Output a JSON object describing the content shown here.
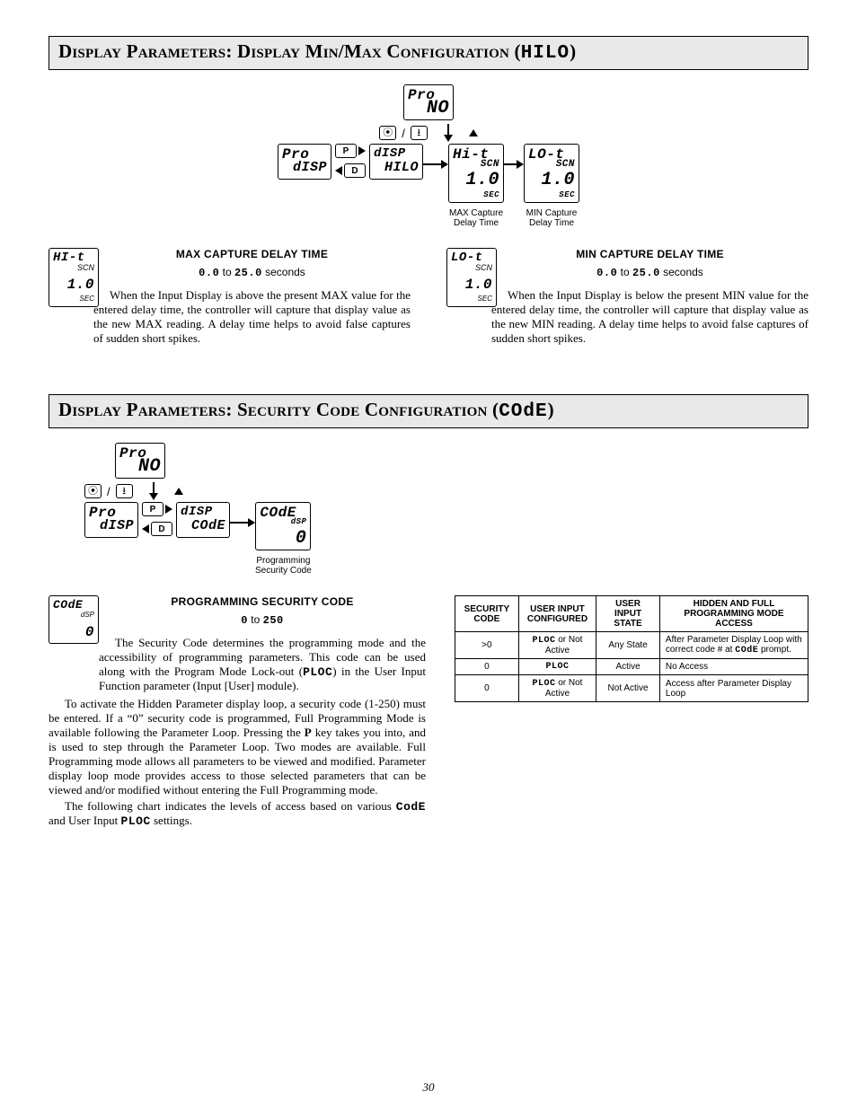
{
  "section1": {
    "title_prefix": "D",
    "title_a": "isplay",
    "title_b": " P",
    "title_c": "arameters",
    "title_mid": ": D",
    "title_d": "isplay",
    "title_e": " M",
    "title_f": "in",
    "title_slash": "/M",
    "title_g": "ax",
    "title_h": " C",
    "title_i": "onfiguration",
    "title_paren_open": " (",
    "title_seg": "HILO",
    "title_paren_close": ")"
  },
  "diagram1": {
    "pro": "Pro",
    "no": "NO",
    "disp": "dISP",
    "hilo": "HILO",
    "hi_t": "Hi-t",
    "lo_t": "LO-t",
    "scn": "SCN",
    "val": "1.0",
    "sec": "SEC",
    "btn_p": "P",
    "btn_d": "D",
    "max_cap_caption_l1": "MAX Capture",
    "max_cap_caption_l2": "Delay Time",
    "min_cap_caption_l1": "MIN Capture",
    "min_cap_caption_l2": "Delay Time"
  },
  "max_block": {
    "lcd_top": "HI-t",
    "lcd_scn": "SCN",
    "lcd_val": "1.0",
    "lcd_sec": "SEC",
    "heading": "MAX CAPTURE DELAY TIME",
    "range_a": "0.0",
    "range_mid": " to ",
    "range_b": "25.0",
    "range_suffix": "  seconds",
    "body": "When the Input Display is above the present MAX value for the entered delay time, the controller will capture that display value as the new MAX reading. A delay time helps to avoid false captures of sudden short spikes."
  },
  "min_block": {
    "lcd_top": "LO-t",
    "lcd_scn": "SCN",
    "lcd_val": "1.0",
    "lcd_sec": "SEC",
    "heading": "MIN CAPTURE DELAY TIME",
    "range_a": "0.0",
    "range_mid": " to ",
    "range_b": "25.0",
    "range_suffix": "  seconds",
    "body": "When the Input Display is below the present MIN value for the entered delay time, the controller will capture that display value as the new MIN reading. A delay time helps to avoid false captures of sudden short spikes."
  },
  "section2": {
    "title_a": "D",
    "title_b": "isplay",
    "title_c": " P",
    "title_d": "arameters",
    "title_mid": ": S",
    "title_e": "ecurity",
    "title_f": " C",
    "title_g": "ode",
    "title_h": " C",
    "title_i": "onfiguration",
    "title_paren_open": " (",
    "title_seg": "COdE",
    "title_paren_close": ")"
  },
  "diagram2": {
    "pro": "Pro",
    "no": "NO",
    "disp": "dISP",
    "code": "COdE",
    "dsp": "dSP",
    "zero": "0",
    "btn_p": "P",
    "btn_d": "D",
    "caption_l1": "Programming",
    "caption_l2": "Security Code"
  },
  "code_block": {
    "lcd_top": "COdE",
    "lcd_dsp": "dSP",
    "lcd_val": "0",
    "heading": "PROGRAMMING SECURITY CODE",
    "range_a": "0",
    "range_mid": " to ",
    "range_b": "250",
    "p1_a": "The Security Code determines the programming mode and the accessibility of programming parameters. This code can be used along with the Program Mode Lock-out (",
    "p1_seg": "PLOC",
    "p1_b": ") in the User Input Function parameter (Input [User] module).",
    "p2_a": "To activate the Hidden Parameter display loop, a security code (1-250) must be entered. If a “0” security code is programmed, Full Programming Mode is available following the Parameter Loop. Pressing the ",
    "p2_key": "P",
    "p2_b": " key takes you into, and is used to step through the Parameter Loop. Two modes are available. Full Programming mode allows all parameters to be viewed and modified. Parameter display loop mode provides access to those selected parameters that can be viewed and/or modified without entering the Full Programming mode.",
    "p3_a": "The following chart indicates the levels of access based on various ",
    "p3_seg1": "CodE",
    "p3_mid": " and User Input ",
    "p3_seg2": "PLOC",
    "p3_b": " settings."
  },
  "table": {
    "h1": "SECURITY CODE",
    "h2": "USER INPUT CONFIGURED",
    "h3": "USER INPUT STATE",
    "h4": "HIDDEN AND FULL PROGRAMMING MODE ACCESS",
    "r1c1": ">0",
    "r1c2a": "PLOC",
    "r1c2b": " or Not Active",
    "r1c3": "Any State",
    "r1c4a": "After Parameter Display Loop with correct code # at ",
    "r1c4b": "COdE",
    "r1c4c": " prompt.",
    "r2c1": "0",
    "r2c2": "PLOC",
    "r2c3": "Active",
    "r2c4": "No Access",
    "r3c1": "0",
    "r3c2a": "PLOC",
    "r3c2b": " or Not Active",
    "r3c3": "Not Active",
    "r3c4": "Access after Parameter Display Loop"
  },
  "page": "30"
}
